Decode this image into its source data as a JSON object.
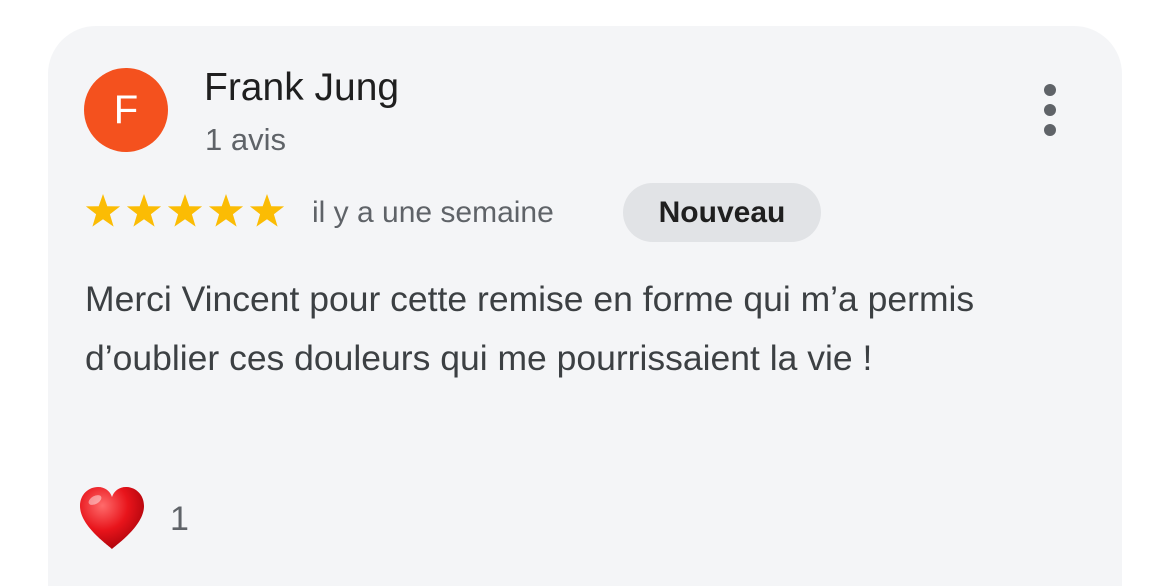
{
  "review": {
    "author": {
      "initial": "F",
      "name": "Frank Jung",
      "review_count": "1 avis",
      "avatar_color": "#f4511e"
    },
    "rating": {
      "stars": 5,
      "max_stars": 5,
      "star_color": "#fbbc04"
    },
    "timestamp": "il y a une semaine",
    "badge": "Nouveau",
    "text": "Merci Vincent pour cette remise en forme qui m’a permis d’oublier ces douleurs qui me pourrissaient la vie !",
    "reactions": {
      "icon": "heart-icon",
      "count": "1"
    },
    "menu_icon": "more-vertical-icon"
  }
}
